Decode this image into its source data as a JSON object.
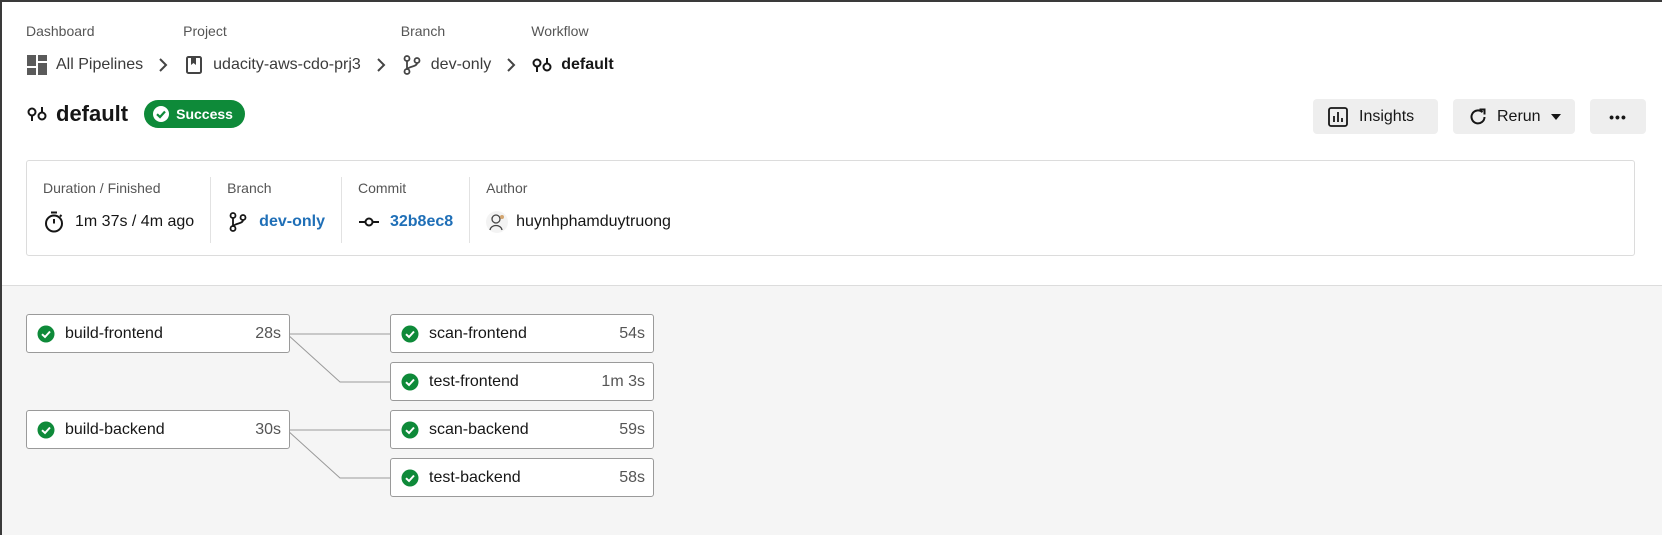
{
  "breadcrumbs": [
    {
      "label": "Dashboard",
      "value": "All Pipelines",
      "icon": "dashboard-grid-icon"
    },
    {
      "label": "Project",
      "value": "udacity-aws-cdo-prj3",
      "icon": "bookmark-icon"
    },
    {
      "label": "Branch",
      "value": "dev-only",
      "icon": "branch-icon"
    },
    {
      "label": "Workflow",
      "value": "default",
      "icon": "workflow-icon"
    }
  ],
  "header": {
    "title": "default",
    "status": "Success",
    "status_color": "#0e8a39"
  },
  "actions": {
    "insights_label": "Insights",
    "rerun_label": "Rerun",
    "more_label": "•••"
  },
  "info": {
    "duration_label": "Duration / Finished",
    "duration_value": "1m 37s / 4m ago",
    "branch_label": "Branch",
    "branch_value": "dev-only",
    "commit_label": "Commit",
    "commit_value": "32b8ec8",
    "author_label": "Author",
    "author_value": "huynhphamduytruong"
  },
  "jobs": {
    "build_frontend": {
      "name": "build-frontend",
      "time": "28s",
      "status": "success"
    },
    "build_backend": {
      "name": "build-backend",
      "time": "30s",
      "status": "success"
    },
    "scan_frontend": {
      "name": "scan-frontend",
      "time": "54s",
      "status": "success"
    },
    "test_frontend": {
      "name": "test-frontend",
      "time": "1m 3s",
      "status": "success"
    },
    "scan_backend": {
      "name": "scan-backend",
      "time": "59s",
      "status": "success"
    },
    "test_backend": {
      "name": "test-backend",
      "time": "58s",
      "status": "success"
    }
  },
  "colors": {
    "success": "#0e8a39",
    "link": "#1f6fb7"
  }
}
